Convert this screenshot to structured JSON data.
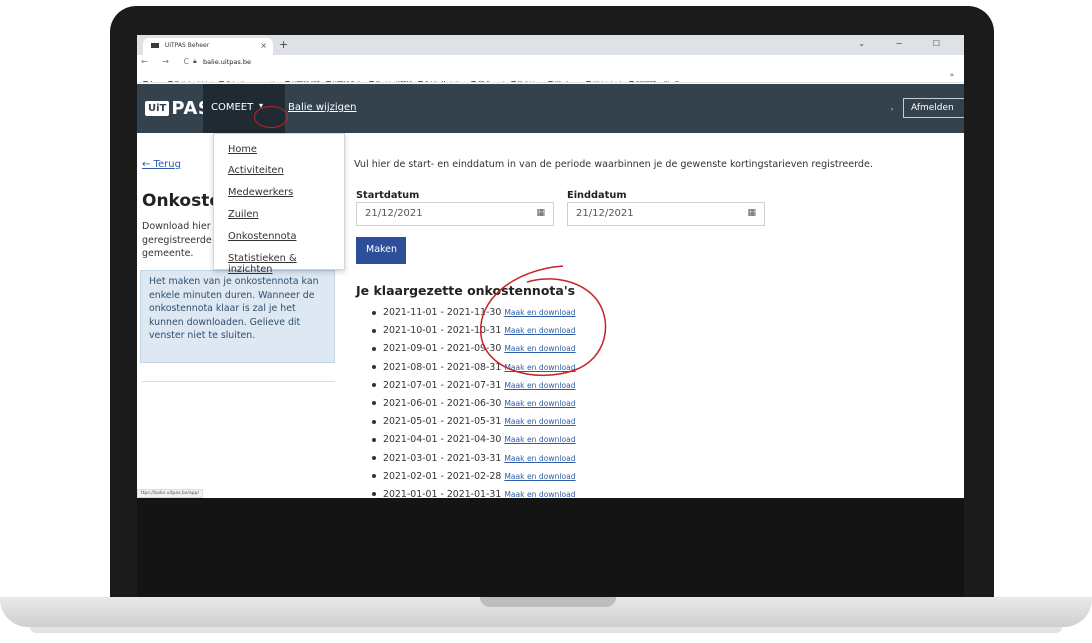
{
  "browser": {
    "tab_title": "UiTPAS Beheer",
    "tab_close": "×",
    "new_tab": "+",
    "window_controls": "⌄  −  ☐",
    "nav_icons": "← → C",
    "url": "balie.uitpas.be",
    "bookmarks": [
      "Apps",
      "Plattelandsloket",
      "Gebruikersaccount |...",
      "UiTPAS KSB",
      "UiTPAS Balie",
      "Start to UiTPAS",
      "Publiq Marketing",
      "FB-Comeet",
      "Mailchimp",
      "Wireframe",
      "Uitdatabank",
      "COMEET — WordPr..."
    ],
    "bookmarks_more": "»",
    "status_url": "ttps://balie.uitpas.be/app/"
  },
  "site_nav": {
    "logo_uit": "UiT",
    "logo_pas": "PAS",
    "counter": "COMEET",
    "caret": "▾",
    "switch_link": "Balie wijzigen",
    "separator": "›",
    "logout": "Afmelden"
  },
  "dropdown": {
    "items": [
      "Home",
      "Activiteiten",
      "Medewerkers",
      "Zuilen",
      "Onkostennota",
      "Statistieken & inzichten"
    ]
  },
  "sidebar": {
    "back_link": "← Terug",
    "page_title": "Onkostennota",
    "intro_text": "Download hier geregistreerde gemeente.",
    "info_text": "Het maken van je onkostennota kan enkele minuten duren. Wanneer de onkostennota klaar is zal je het kunnen downloaden. Gelieve dit venster niet te sluiten."
  },
  "main": {
    "instruction": "Vul hier de start- en einddatum in van de periode waarbinnen je de gewenste kortingstarieven registreerde.",
    "start_label": "Startdatum",
    "start_value": "21/12/2021",
    "end_label": "Einddatum",
    "end_value": "21/12/2021",
    "calendar_icon": "▦",
    "make_button": "Maken",
    "list_title": "Je klaargezette onkostennota's",
    "download_label": "Maak en download",
    "periods": [
      "2021-11-01 - 2021-11-30",
      "2021-10-01 - 2021-10-31",
      "2021-09-01 - 2021-09-30",
      "2021-08-01 - 2021-08-31",
      "2021-07-01 - 2021-07-31",
      "2021-06-01 - 2021-06-30",
      "2021-05-01 - 2021-05-31",
      "2021-04-01 - 2021-04-30",
      "2021-03-01 - 2021-03-31",
      "2021-02-01 - 2021-02-28",
      "2021-01-01 - 2021-01-31"
    ]
  },
  "colors": {
    "navbar": "#34424e",
    "link": "#2f5ea8",
    "button": "#2d4f9a",
    "info_bg": "#dde8f3",
    "annotation": "#c8232a"
  }
}
